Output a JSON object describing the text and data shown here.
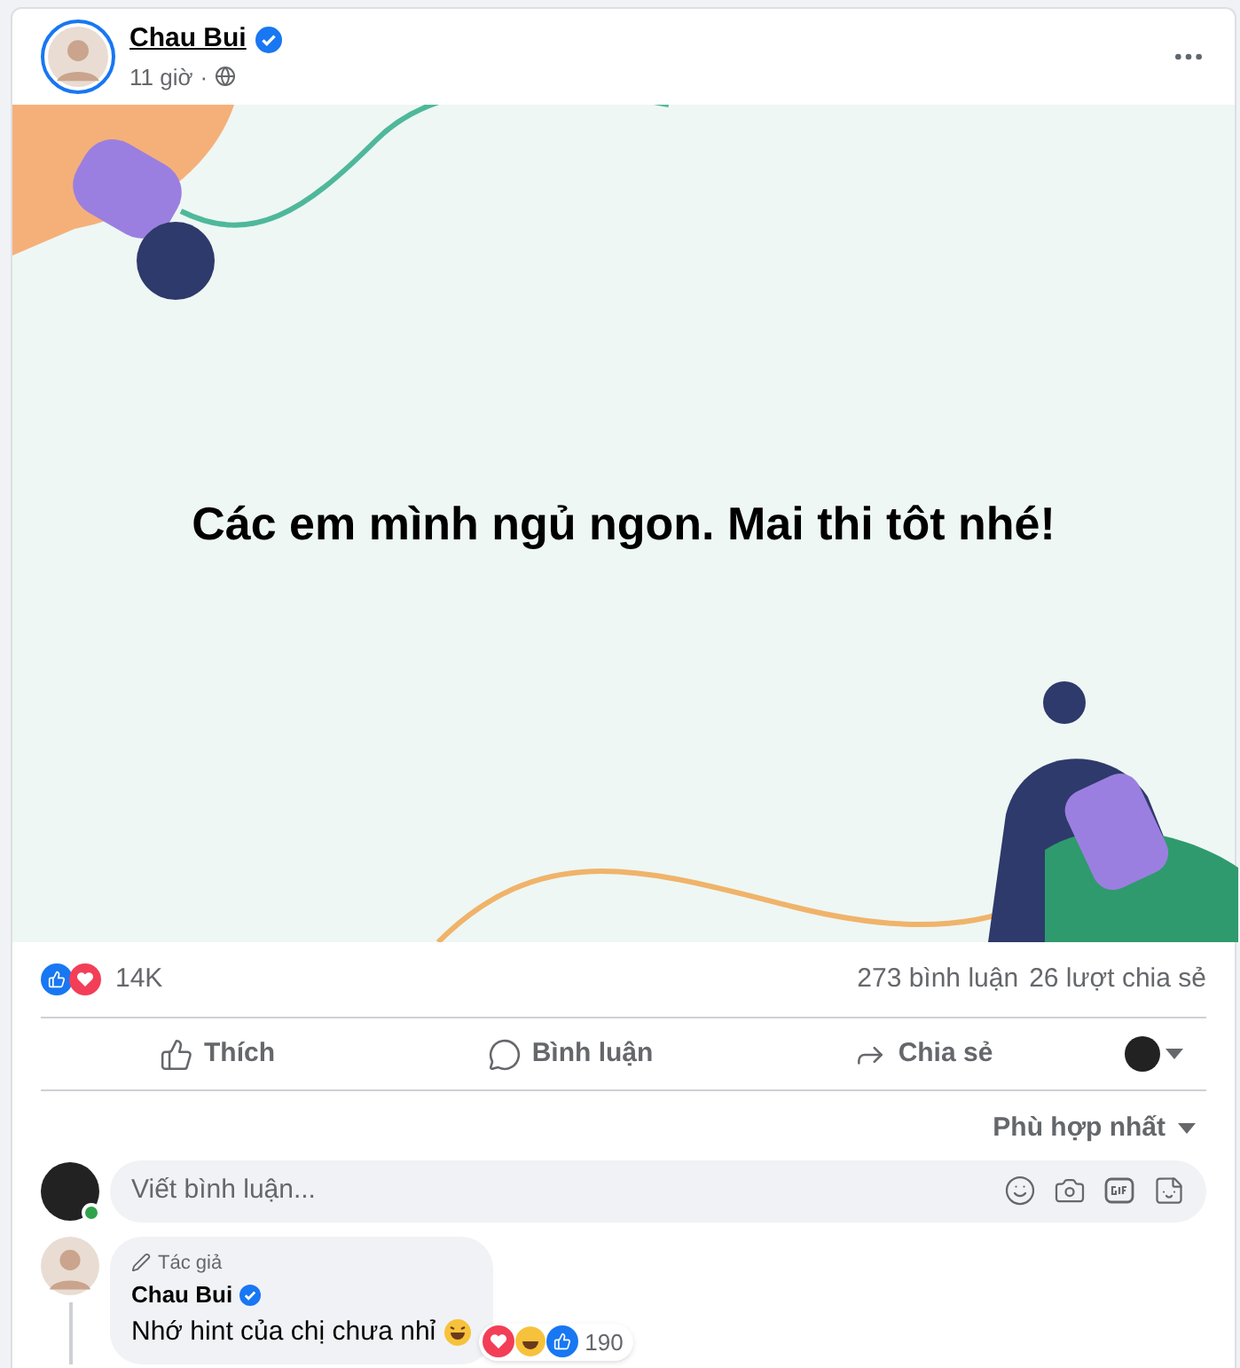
{
  "post": {
    "author": "Chau Bui",
    "verified": true,
    "time": "11 giờ",
    "separator": "·",
    "message": "Các em mình ngủ ngon. Mai thi tôt nhé!"
  },
  "stats": {
    "reactions": "14K",
    "comments": "273 bình luận",
    "shares": "26 lượt chia sẻ"
  },
  "actions": [
    "Thích",
    "Bình luận",
    "Chia sẻ"
  ],
  "sort": "Phù hợp nhất",
  "composer": {
    "placeholder": "Viết bình luận...",
    "online": true
  },
  "comments": [
    {
      "badge": "Tác giả",
      "author": "Chau Bui",
      "verified": true,
      "text": "Nhớ hint của chị chưa nhỉ",
      "reaction_count": "190"
    }
  ]
}
